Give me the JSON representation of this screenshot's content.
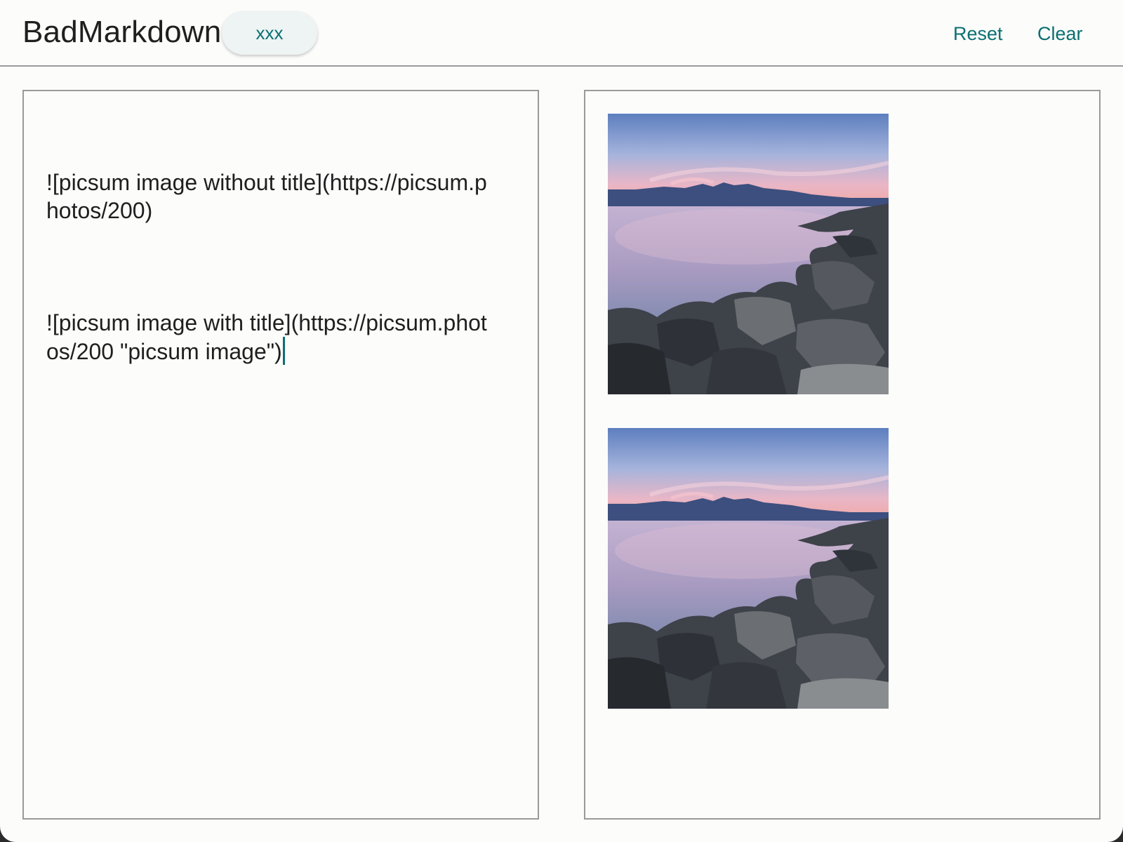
{
  "header": {
    "app_title": "BadMarkdown",
    "document_chip": "xxx",
    "reset_label": "Reset",
    "clear_label": "Clear"
  },
  "editor": {
    "paragraphs": [
      "![picsum image without title](https://picsum.photos/200)",
      "![picsum image with title](https://picsum.photos/200 \"picsum image\")"
    ]
  },
  "preview": {
    "images": [
      {
        "alt": "picsum image without title",
        "subject": "seascape-sunset-rocks"
      },
      {
        "alt": "picsum image with title",
        "title": "picsum image",
        "subject": "seascape-sunset-rocks"
      }
    ]
  },
  "colors": {
    "accent": "#0b6f72",
    "text": "#1f1f1f",
    "border": "#9a9a9a",
    "background": "#fcfcfb",
    "chip_background": "#eef3f4"
  }
}
